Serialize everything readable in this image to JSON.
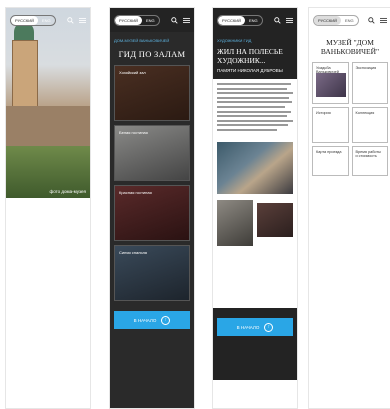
{
  "header": {
    "lang_left": "РУССКИЙ",
    "lang_right": "ENG"
  },
  "screen1": {
    "caption": "фото дома-музея"
  },
  "screen2": {
    "breadcrumb": "ДОМ-МУЗЕЙ ВАНЬКОВИЧЕЙ",
    "title": "ГИД ПО ЗАЛАМ",
    "halls": [
      "Хозяйский зал",
      "Белая гостиная",
      "Красная гостиная",
      "Синяя спальня"
    ],
    "button": "В НАЧАЛО"
  },
  "screen3": {
    "breadcrumb": "ХУДОЖНИКИ ГИД",
    "title": "ЖИЛ НА ПОЛЕСЬЕ ХУДОЖНИК...",
    "subtitle": "ПАМЯТИ НИКОЛАЯ ДУБРОВЫ",
    "button": "В НАЧАЛО"
  },
  "screen4": {
    "title": "МУЗЕЙ \"ДОМ ВАНЬКОВИЧЕЙ\"",
    "cells": [
      "Усадьба Ваньковичей",
      "Экспозиция",
      "История",
      "Коллекция",
      "Карта проезда",
      "Время работы и стоимость"
    ]
  }
}
